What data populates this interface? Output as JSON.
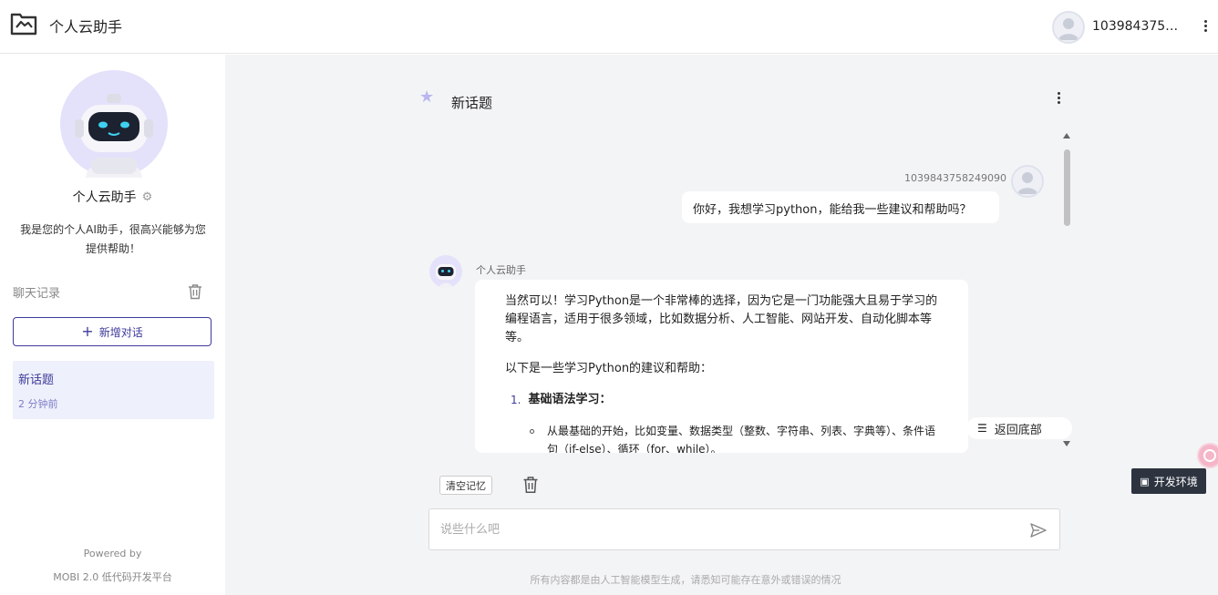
{
  "header": {
    "app_title": "个人云助手",
    "user_name": "10398437582..."
  },
  "sidebar": {
    "bot_name": "个人云助手",
    "bot_description": "我是您的个人AI助手，很高兴能够为您提供帮助！",
    "history_label": "聊天记录",
    "new_chat_label": "新增对话",
    "topics": [
      {
        "title": "新话题",
        "time": "2 分钟前"
      }
    ],
    "powered_by": "Powered by",
    "platform": "MOBI 2.0 低代码开发平台"
  },
  "conversation": {
    "title": "新话题",
    "user_message": {
      "sender_id": "1039843758249090",
      "text": "你好，我想学习python，能给我一些建议和帮助吗？"
    },
    "bot_message": {
      "sender_name": "个人云助手",
      "para1": "当然可以！学习Python是一个非常棒的选择，因为它是一门功能强大且易于学习的编程语言，适用于很多领域，比如数据分析、人工智能、网站开发、自动化脚本等等。",
      "para2": "以下是一些学习Python的建议和帮助：",
      "item1_number": "1.",
      "item1_title": "基础语法学习：",
      "item1_sub1": "从最基础的开始，比如变量、数据类型（整数、字符串、列表、字典等）、条件语句（if-else）、循环（for、while）。"
    },
    "back_to_bottom": "返回底部",
    "clear_memory": "清空记忆",
    "input_placeholder": "说些什么吧",
    "disclaimer": "所有内容都是由人工智能模型生成，请悉知可能存在意外或错误的情况"
  },
  "float": {
    "dev_env_label": "开发环境"
  },
  "colors": {
    "accent": "#3d3a9a",
    "topic_bg": "#eef1fb",
    "main_bg": "#f3f4f6",
    "dev_env_bg": "#2d3440"
  }
}
